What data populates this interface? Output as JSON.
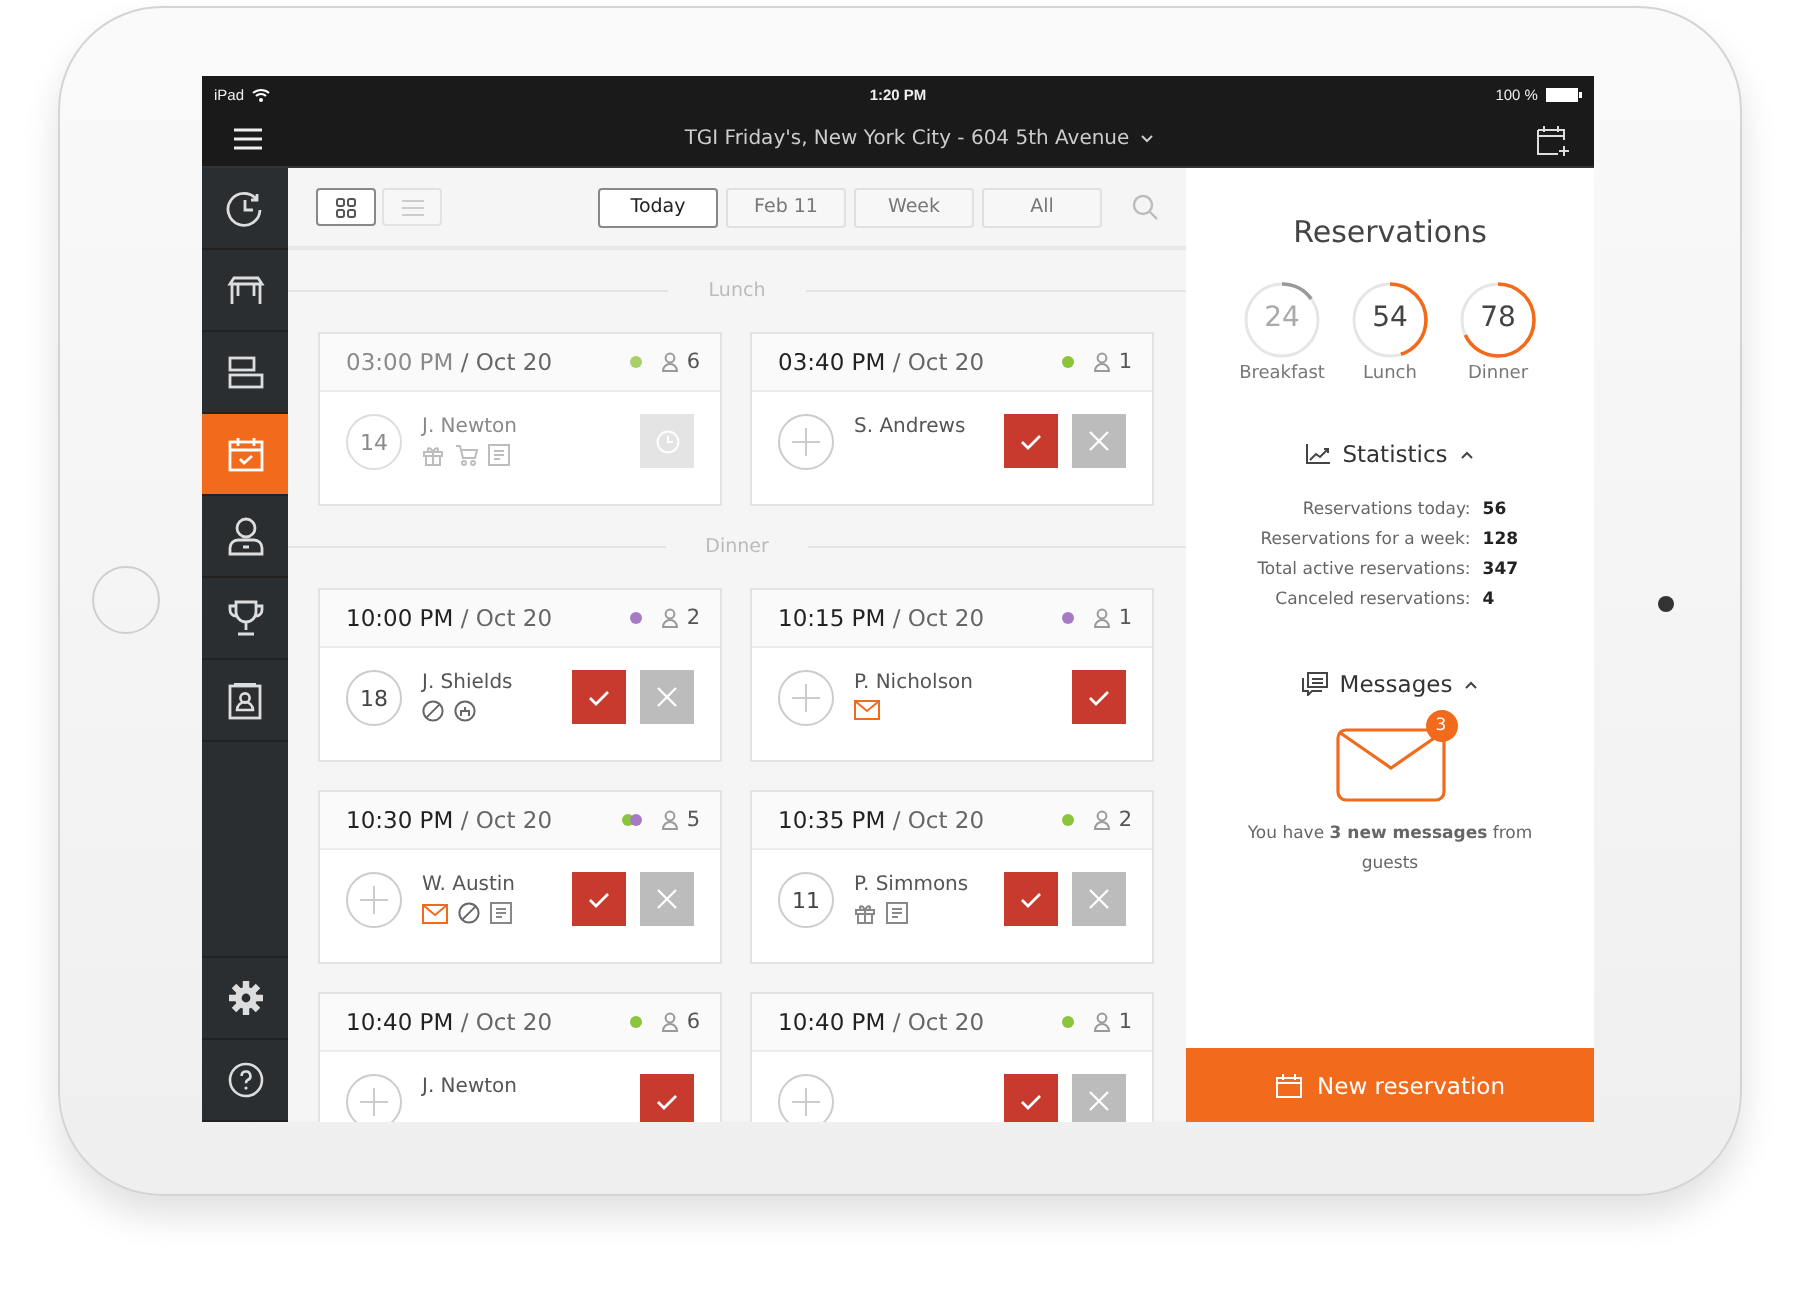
{
  "status_bar": {
    "device": "iPad",
    "time": "1:20 PM",
    "battery": "100 %"
  },
  "top_bar": {
    "title": "TGI Friday's, New York City - 604 5th Avenue"
  },
  "sidebar": {
    "items": [
      {
        "selected": false
      },
      {
        "selected": false
      },
      {
        "selected": false
      },
      {
        "selected": true
      },
      {
        "selected": false
      },
      {
        "selected": false
      },
      {
        "selected": false
      }
    ]
  },
  "toolbar": {
    "views": [
      {
        "selected": true
      },
      {
        "selected": false
      }
    ],
    "filters": [
      {
        "label": "Today",
        "selected": true
      },
      {
        "label": "Feb 11",
        "selected": false
      },
      {
        "label": "Week",
        "selected": false
      },
      {
        "label": "All",
        "selected": false
      }
    ]
  },
  "sections": [
    {
      "title": "Lunch",
      "cards": [
        {
          "time": "03:00 PM",
          "date": "/ Oct 20",
          "dimmed": true,
          "dots": [
            {
              "color": "#a8cf6a"
            }
          ],
          "guests": "6",
          "table": "14",
          "name": "J. Newton",
          "icons": [
            {
              "kind": "gift"
            },
            {
              "kind": "stroller"
            },
            {
              "kind": "note"
            }
          ],
          "actions": [
            {
              "kind": "pending"
            }
          ]
        },
        {
          "time": "03:40 PM",
          "date": "/ Oct 20",
          "dimmed": false,
          "dots": [
            {
              "color": "#8cc43c"
            }
          ],
          "guests": "1",
          "name": "S. Andrews",
          "actions": [
            {
              "kind": "confirm"
            },
            {
              "kind": "decline"
            }
          ]
        }
      ]
    },
    {
      "title": "Dinner",
      "cards": [
        {
          "time": "10:00 PM",
          "date": "/ Oct 20",
          "dimmed": false,
          "dots": [
            {
              "color": "#a77bc4"
            }
          ],
          "guests": "2",
          "table": "18",
          "name": "J. Shields",
          "icons": [
            {
              "kind": "forbidden"
            },
            {
              "kind": "cake"
            }
          ],
          "actions": [
            {
              "kind": "confirm"
            },
            {
              "kind": "decline"
            }
          ]
        },
        {
          "time": "10:15 PM",
          "date": "/ Oct 20",
          "dimmed": false,
          "dots": [
            {
              "color": "#a77bc4"
            }
          ],
          "guests": "1",
          "name": "P. Nicholson",
          "icons": [
            {
              "kind": "mail"
            }
          ],
          "actions": [
            {
              "kind": "confirm"
            }
          ]
        },
        {
          "time": "10:30 PM",
          "date": "/ Oct 20",
          "dimmed": false,
          "dots": [
            {
              "color": "#8cc43c"
            },
            {
              "color": "#a77bc4"
            }
          ],
          "guests": "5",
          "name": "W. Austin",
          "icons": [
            {
              "kind": "mail"
            },
            {
              "kind": "forbidden"
            },
            {
              "kind": "note"
            }
          ],
          "actions": [
            {
              "kind": "confirm"
            },
            {
              "kind": "decline"
            }
          ]
        },
        {
          "time": "10:35 PM",
          "date": "/ Oct 20",
          "dimmed": false,
          "dots": [
            {
              "color": "#8cc43c"
            }
          ],
          "guests": "2",
          "table": "11",
          "name": "P. Simmons",
          "icons": [
            {
              "kind": "gift"
            },
            {
              "kind": "note"
            }
          ],
          "actions": [
            {
              "kind": "confirm"
            },
            {
              "kind": "decline"
            }
          ]
        },
        {
          "time": "10:40 PM",
          "date": "/ Oct 20",
          "dimmed": false,
          "dots": [
            {
              "color": "#8cc43c"
            }
          ],
          "guests": "6",
          "name": "J. Newton",
          "actions": [
            {
              "kind": "confirm"
            }
          ]
        },
        {
          "time": "10:40 PM",
          "date": "/ Oct 20",
          "dimmed": false,
          "dots": [
            {
              "color": "#8cc43c"
            }
          ],
          "guests": "1",
          "actions": [
            {
              "kind": "confirm"
            },
            {
              "kind": "decline"
            }
          ]
        }
      ]
    }
  ],
  "panel": {
    "title": "Reservations",
    "meals": [
      {
        "value": "24",
        "label": "Breakfast",
        "level": 0.15,
        "color": "#999999"
      },
      {
        "value": "54",
        "label": "Lunch",
        "level": 0.45,
        "color": "#f26b1d"
      },
      {
        "value": "78",
        "label": "Dinner",
        "level": 0.68,
        "color": "#f26b1d"
      }
    ],
    "statistics": {
      "title": "Statistics",
      "expanded": true,
      "rows": [
        {
          "label": "Reservations today:",
          "value": "56"
        },
        {
          "label": "Reservations for a week:",
          "value": "128"
        },
        {
          "label": "Total active reservations:",
          "value": "347"
        },
        {
          "label": "Canceled reservations:",
          "value": "4"
        }
      ]
    },
    "messages": {
      "title": "Messages",
      "expanded": true,
      "badge": "3",
      "text": "You have **3 new messages** from guests"
    },
    "button": "New reservation"
  }
}
